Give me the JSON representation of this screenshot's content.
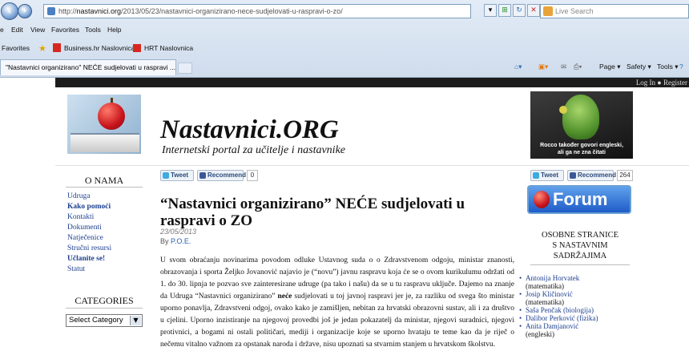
{
  "browser": {
    "url_prefix": "http://",
    "url_domain": "nastavnici.org",
    "url_path": "/2013/05/23/nastavnici-organizirano-nece-sudjelovati-u-raspravi-o-zo/",
    "search_placeholder": "Live Search",
    "menu": [
      "e",
      "Edit",
      "View",
      "Favorites",
      "Tools",
      "Help"
    ],
    "favorites_label": "Favorites",
    "favorite_links": [
      "Business.hr  Naslovnica",
      "HRT Naslovnica"
    ],
    "tab_title": "\"Nastavnici organizirano\" NEĆE sudjelovati u raspravi ...",
    "commands": [
      "Page ▾",
      "Safety ▾",
      "Tools ▾"
    ]
  },
  "site": {
    "login_text": "Log In  ●  Register",
    "title": "Nastavnici.ORG",
    "subtitle": "Internetski portal za učitelje i nastavnike",
    "banner_caption_1": "Rocco također govori engleski,",
    "banner_caption_2": "ali ga ne zna čitati"
  },
  "sidebar": {
    "heading_about": "O NAMA",
    "items": [
      {
        "label": "Udruga",
        "bold": false
      },
      {
        "label": "Kako pomoći",
        "bold": true
      },
      {
        "label": "Kontakti",
        "bold": false
      },
      {
        "label": "Dokumenti",
        "bold": false
      },
      {
        "label": "Natječenice",
        "bold": false
      },
      {
        "label": "Stručni resursi",
        "bold": false
      },
      {
        "label": "Učlanite se!",
        "bold": true
      },
      {
        "label": "Statut",
        "bold": false
      }
    ],
    "heading_categories": "CATEGORIES",
    "select_value": "Select Category"
  },
  "social": {
    "tweet": "Tweet",
    "recommend": "Recommend",
    "count_left": "0",
    "count_right": "264"
  },
  "article": {
    "title": "“Nastavnici organizirano” NEĆE sudjelovati u raspravi o ZO",
    "date": "23/05/2013",
    "by_label": "By",
    "author": "P.O.E.",
    "p1": "U svom obraćanju novinarima povodom odluke Ustavnog suda o o Zdravstvenom odgoju, ministar znanosti, obrazovanja i sporta Željko Jovanović najavio je (“novu”) javnu raspravu koja će se o ovom kurikulumu održati od 1. do 30. lipnja te pozvao sve zainteresirane udruge (pa tako i našu) da se u tu raspravu uključe. Dajemo na znanje da Udruga “Nastavnici organizirano” ",
    "p1_bold": "neće",
    "p1_rest": " sudjelovati u toj javnoj raspravi jer je, za razliku od svega što ministar uporno ponavlja, Zdravstveni odgoj, ovako kako je zamišljen, nebitan za hrvatski obrazovni sustav, ali i za društvo u cjelini. Uporno inzistiranje na njegovoj provedbi još je jedan pokazatelj da ministar, njegovi suradnici, njegovi protivnici, a bogami ni ostali političari, mediji i organizacije koje se uporno hvataju te teme kao da je riječ o nečemu vitalno važnom za opstanak naroda i države, nisu upoznati sa stvarnim stanjem u hrvatskom školstvu."
  },
  "right_sidebar": {
    "forum_label": "Forum",
    "heading": [
      "OSOBNE STRANICE",
      "S NASTAVNIM",
      "SADRŽAJIMA"
    ],
    "people": [
      {
        "name": "Antonija Horvatek",
        "subject": "(matematika)"
      },
      {
        "name": "Josip Kličinović",
        "subject": "(matematika)"
      },
      {
        "name": "Saša Penčak (biologija)",
        "subject": ""
      },
      {
        "name": "Dalibor Perković (fizika)",
        "subject": ""
      },
      {
        "name": "Anita Damjanović",
        "subject": "(engleski)"
      }
    ]
  },
  "colors": {
    "link": "#1d3f8f",
    "forum_blue": "#1f5cc7",
    "top_strip": "#1c1c1c"
  }
}
